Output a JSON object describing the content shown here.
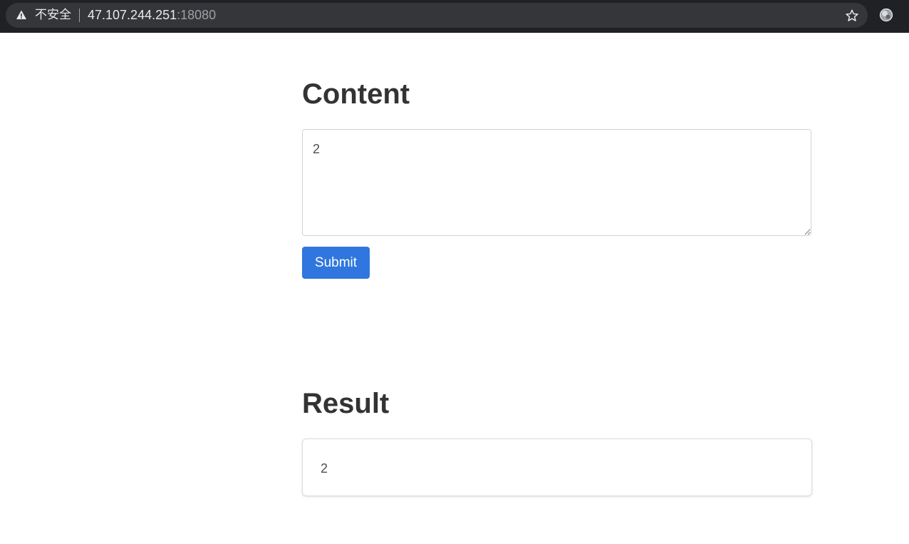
{
  "browser": {
    "security_label": "不安全",
    "url_host": "47.107.244.251",
    "url_port": ":18080",
    "icons": {
      "warning": "warning-icon",
      "bookmark": "star-icon",
      "extension": "globe-icon"
    }
  },
  "form": {
    "title": "Content",
    "textarea_value": "2",
    "submit_label": "Submit"
  },
  "result": {
    "title": "Result",
    "value": "2"
  },
  "colors": {
    "accent": "#2f76de",
    "heading": "#333333",
    "browser_bar": "#202124"
  }
}
